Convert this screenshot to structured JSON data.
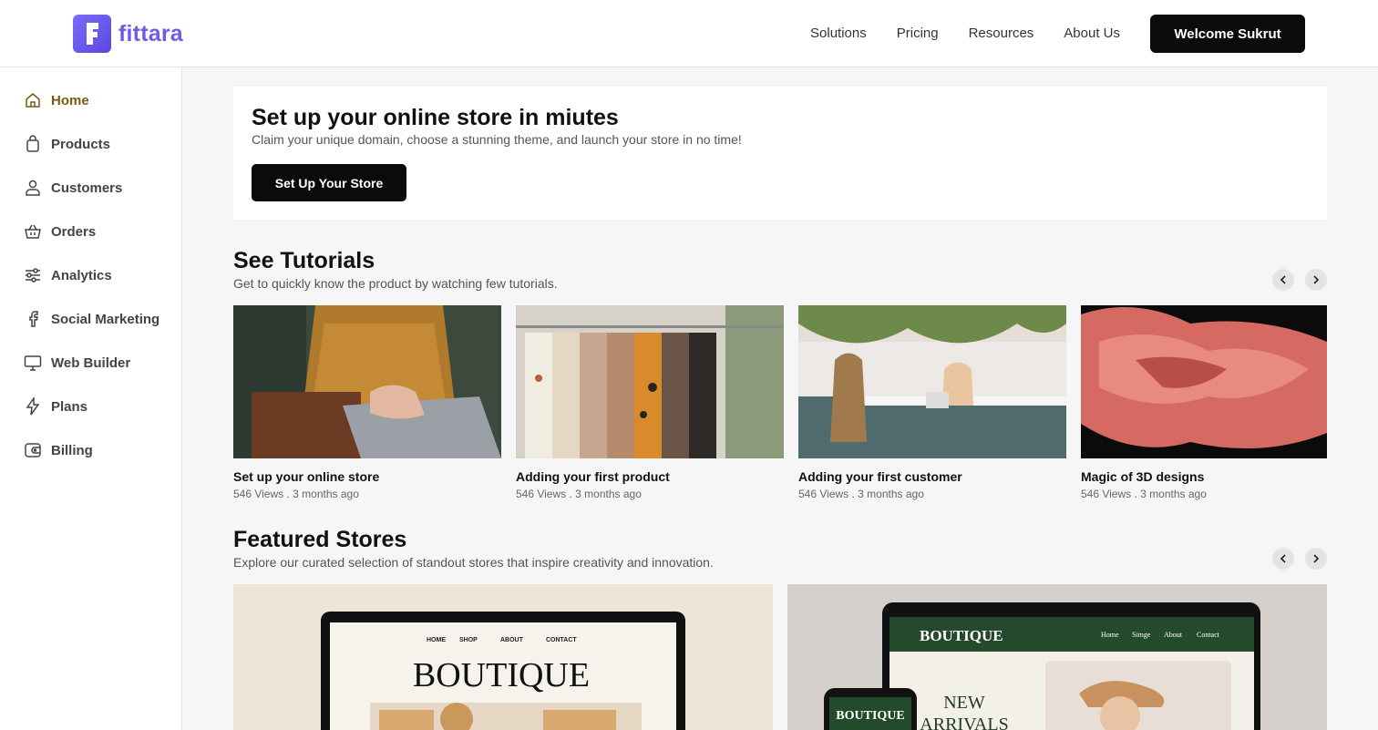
{
  "header": {
    "brand": "fittara",
    "nav": [
      "Solutions",
      "Pricing",
      "Resources",
      "About Us"
    ],
    "welcome_button": "Welcome Sukrut"
  },
  "sidebar": {
    "items": [
      {
        "label": "Home",
        "icon": "home-icon"
      },
      {
        "label": "Products",
        "icon": "shopping-bag-icon"
      },
      {
        "label": "Customers",
        "icon": "user-icon"
      },
      {
        "label": "Orders",
        "icon": "basket-icon"
      },
      {
        "label": "Analytics",
        "icon": "sliders-icon"
      },
      {
        "label": "Social Marketing",
        "icon": "facebook-icon"
      },
      {
        "label": "Web Builder",
        "icon": "monitor-icon"
      },
      {
        "label": "Plans",
        "icon": "lightning-icon"
      },
      {
        "label": "Billing",
        "icon": "wallet-icon"
      }
    ],
    "active": "Home"
  },
  "hero": {
    "title": "Set up your online store in miutes",
    "subtitle": "Claim your unique domain, choose a stunning theme, and launch your store in no time!",
    "button": "Set Up Your Store"
  },
  "tutorials": {
    "title": "See Tutorials",
    "subtitle": "Get to quickly know the product by watching few tutorials.",
    "items": [
      {
        "title": "Set up your online store",
        "meta": "546 Views . 3 months ago"
      },
      {
        "title": "Adding your first product",
        "meta": "546 Views . 3 months ago"
      },
      {
        "title": "Adding your first customer",
        "meta": "546 Views . 3 months ago"
      },
      {
        "title": "Magic of 3D designs",
        "meta": "546 Views . 3 months ago"
      }
    ]
  },
  "featured": {
    "title": "Featured Stores",
    "subtitle": "Explore our curated selection of standout stores that inspire creativity and innovation.",
    "store1": {
      "nav": [
        "HOME",
        "SHOP",
        "ABOUT",
        "CONTACT"
      ],
      "brand": "BOUTIQUE"
    },
    "store2": {
      "nav": [
        "Home",
        "Simge",
        "About",
        "Contact"
      ],
      "brand": "BOUTIQUE",
      "headline1": "NEW",
      "headline2": "ARRIVALS"
    }
  },
  "colors": {
    "brand": "#6c5ce7",
    "active_nav": "#7a5a10",
    "primary_button": "#0b0b0b"
  }
}
